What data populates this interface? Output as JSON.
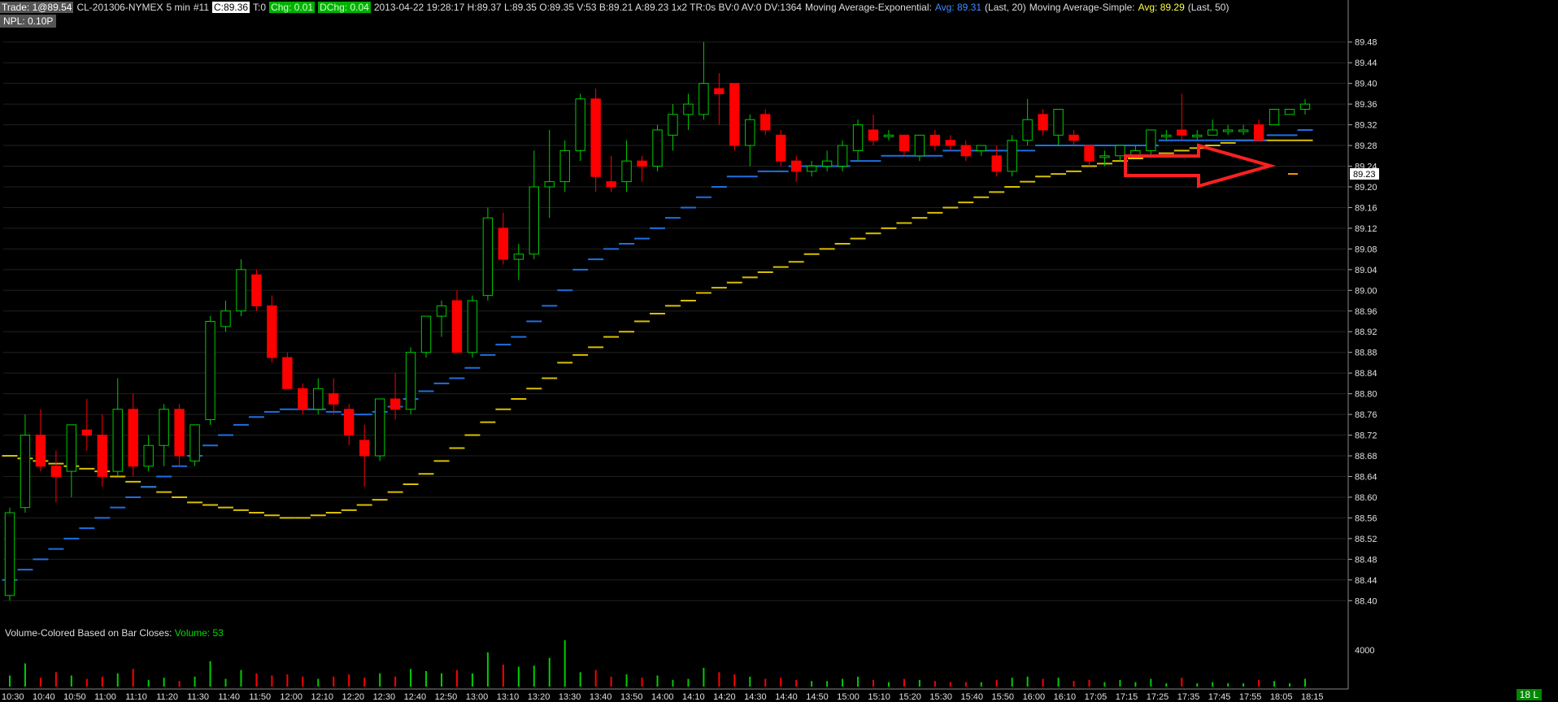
{
  "header": {
    "trade_label": "Trade: 1@89.54",
    "symbol": "CL-201306-NYMEX",
    "interval": "5 min",
    "bar_no": "#11",
    "close_chip": "C:89.36",
    "t_chip": "T:0",
    "chg_chip": "Chg: 0.01",
    "dchg_chip": "DChg: 0.04",
    "stats": "2013-04-22 19:28:17 H:89.37 L:89.35 O:89.35 V:53 B:89.21 A:89.23 1x2 TR:0s BV:0 AV:0 DV:1364",
    "ema_label": "Moving Average-Exponential:",
    "ema_avg": "Avg: 89.31",
    "ema_period": "(Last, 20)",
    "sma_label": "Moving Average-Simple:",
    "sma_avg": "Avg: 89.29",
    "sma_period": "(Last, 50)"
  },
  "npl": "NPL: 0.10P",
  "volume_label": "Volume-Colored Based on Bar Closes:",
  "volume_value": "Volume: 53",
  "price_tag": "89.23",
  "badge": "18 L",
  "colors": {
    "up": "#00cc00",
    "down": "#ff0000",
    "ema": "#1f6fe0",
    "sma": "#d8c000",
    "arrow": "#ff2020",
    "grid": "#202020",
    "axis_text": "#e0e0e0",
    "header_chip_gray": "#555555",
    "header_chip_green": "#00b000",
    "ema_text": "#3f8cff",
    "sma_text": "#ffff40",
    "badge_bg": "#008800"
  },
  "chart_data": {
    "type": "candlestick",
    "grid": true,
    "ylim": [
      88.38,
      89.5
    ],
    "yticks": [
      "89.48",
      "89.44",
      "89.40",
      "89.36",
      "89.32",
      "89.28",
      "89.24",
      "89.20",
      "89.16",
      "89.12",
      "89.08",
      "89.04",
      "89.00",
      "88.96",
      "88.92",
      "88.88",
      "88.84",
      "88.80",
      "88.76",
      "88.72",
      "88.68",
      "88.64",
      "88.60",
      "88.56",
      "88.52",
      "88.48",
      "88.44",
      "88.40"
    ],
    "volume_tick": "4000",
    "xticks": [
      "10:30",
      "10:40",
      "10:50",
      "11:00",
      "11:10",
      "11:20",
      "11:30",
      "11:40",
      "11:50",
      "12:00",
      "12:10",
      "12:20",
      "12:30",
      "12:40",
      "12:50",
      "13:00",
      "13:10",
      "13:20",
      "13:30",
      "13:40",
      "13:50",
      "14:00",
      "14:10",
      "14:20",
      "14:30",
      "14:40",
      "14:50",
      "15:00",
      "15:10",
      "15:20",
      "15:30",
      "15:40",
      "15:50",
      "16:00",
      "16:10",
      "17:05",
      "17:15",
      "17:25",
      "17:35",
      "17:45",
      "17:55",
      "18:05",
      "18:15"
    ],
    "bars": [
      {
        "o": 88.41,
        "h": 88.58,
        "l": 88.4,
        "c": 88.57,
        "v": 1000
      },
      {
        "o": 88.58,
        "h": 88.76,
        "l": 88.57,
        "c": 88.72,
        "v": 2100
      },
      {
        "o": 88.72,
        "h": 88.77,
        "l": 88.65,
        "c": 88.66,
        "v": 800
      },
      {
        "o": 88.66,
        "h": 88.69,
        "l": 88.59,
        "c": 88.64,
        "v": 1300
      },
      {
        "o": 88.65,
        "h": 88.74,
        "l": 88.6,
        "c": 88.74,
        "v": 1000
      },
      {
        "o": 88.73,
        "h": 88.79,
        "l": 88.69,
        "c": 88.72,
        "v": 700
      },
      {
        "o": 88.72,
        "h": 88.76,
        "l": 88.62,
        "c": 88.64,
        "v": 900
      },
      {
        "o": 88.65,
        "h": 88.83,
        "l": 88.64,
        "c": 88.77,
        "v": 1200
      },
      {
        "o": 88.77,
        "h": 88.8,
        "l": 88.64,
        "c": 88.66,
        "v": 1600
      },
      {
        "o": 88.66,
        "h": 88.72,
        "l": 88.65,
        "c": 88.7,
        "v": 600
      },
      {
        "o": 88.7,
        "h": 88.78,
        "l": 88.66,
        "c": 88.77,
        "v": 800
      },
      {
        "o": 88.77,
        "h": 88.78,
        "l": 88.66,
        "c": 88.68,
        "v": 500
      },
      {
        "o": 88.67,
        "h": 88.74,
        "l": 88.66,
        "c": 88.74,
        "v": 900
      },
      {
        "o": 88.75,
        "h": 88.95,
        "l": 88.74,
        "c": 88.94,
        "v": 2300
      },
      {
        "o": 88.93,
        "h": 88.98,
        "l": 88.92,
        "c": 88.96,
        "v": 700
      },
      {
        "o": 88.96,
        "h": 89.06,
        "l": 88.95,
        "c": 89.04,
        "v": 1500
      },
      {
        "o": 89.03,
        "h": 89.04,
        "l": 88.96,
        "c": 88.97,
        "v": 1200
      },
      {
        "o": 88.97,
        "h": 88.99,
        "l": 88.86,
        "c": 88.87,
        "v": 1000
      },
      {
        "o": 88.87,
        "h": 88.88,
        "l": 88.81,
        "c": 88.81,
        "v": 1100
      },
      {
        "o": 88.81,
        "h": 88.82,
        "l": 88.76,
        "c": 88.77,
        "v": 900
      },
      {
        "o": 88.77,
        "h": 88.83,
        "l": 88.76,
        "c": 88.81,
        "v": 700
      },
      {
        "o": 88.8,
        "h": 88.83,
        "l": 88.76,
        "c": 88.78,
        "v": 900
      },
      {
        "o": 88.77,
        "h": 88.78,
        "l": 88.7,
        "c": 88.72,
        "v": 1100
      },
      {
        "o": 88.71,
        "h": 88.74,
        "l": 88.62,
        "c": 88.68,
        "v": 800
      },
      {
        "o": 88.68,
        "h": 88.79,
        "l": 88.67,
        "c": 88.79,
        "v": 1200
      },
      {
        "o": 88.79,
        "h": 88.84,
        "l": 88.75,
        "c": 88.77,
        "v": 900
      },
      {
        "o": 88.77,
        "h": 88.89,
        "l": 88.76,
        "c": 88.88,
        "v": 1600
      },
      {
        "o": 88.88,
        "h": 88.95,
        "l": 88.87,
        "c": 88.95,
        "v": 1400
      },
      {
        "o": 88.95,
        "h": 88.98,
        "l": 88.91,
        "c": 88.97,
        "v": 1200
      },
      {
        "o": 88.98,
        "h": 89.0,
        "l": 88.88,
        "c": 88.88,
        "v": 1500
      },
      {
        "o": 88.88,
        "h": 88.99,
        "l": 88.87,
        "c": 88.98,
        "v": 1200
      },
      {
        "o": 88.99,
        "h": 89.16,
        "l": 88.98,
        "c": 89.14,
        "v": 3100
      },
      {
        "o": 89.12,
        "h": 89.15,
        "l": 89.05,
        "c": 89.06,
        "v": 2000
      },
      {
        "o": 89.06,
        "h": 89.09,
        "l": 89.02,
        "c": 89.07,
        "v": 1800
      },
      {
        "o": 89.07,
        "h": 89.27,
        "l": 89.06,
        "c": 89.2,
        "v": 1900
      },
      {
        "o": 89.2,
        "h": 89.31,
        "l": 89.14,
        "c": 89.21,
        "v": 2600
      },
      {
        "o": 89.21,
        "h": 89.29,
        "l": 89.19,
        "c": 89.27,
        "v": 4200
      },
      {
        "o": 89.27,
        "h": 89.38,
        "l": 89.25,
        "c": 89.37,
        "v": 1300
      },
      {
        "o": 89.37,
        "h": 89.39,
        "l": 89.19,
        "c": 89.22,
        "v": 1500
      },
      {
        "o": 89.21,
        "h": 89.26,
        "l": 89.19,
        "c": 89.2,
        "v": 900
      },
      {
        "o": 89.21,
        "h": 89.29,
        "l": 89.19,
        "c": 89.25,
        "v": 1100
      },
      {
        "o": 89.25,
        "h": 89.26,
        "l": 89.21,
        "c": 89.24,
        "v": 800
      },
      {
        "o": 89.24,
        "h": 89.32,
        "l": 89.23,
        "c": 89.31,
        "v": 1000
      },
      {
        "o": 89.3,
        "h": 89.36,
        "l": 89.27,
        "c": 89.34,
        "v": 600
      },
      {
        "o": 89.34,
        "h": 89.38,
        "l": 89.31,
        "c": 89.36,
        "v": 700
      },
      {
        "o": 89.34,
        "h": 89.48,
        "l": 89.33,
        "c": 89.4,
        "v": 1700
      },
      {
        "o": 89.39,
        "h": 89.42,
        "l": 89.32,
        "c": 89.38,
        "v": 1300
      },
      {
        "o": 89.4,
        "h": 89.4,
        "l": 89.27,
        "c": 89.28,
        "v": 1100
      },
      {
        "o": 89.28,
        "h": 89.34,
        "l": 89.24,
        "c": 89.33,
        "v": 900
      },
      {
        "o": 89.34,
        "h": 89.35,
        "l": 89.3,
        "c": 89.31,
        "v": 700
      },
      {
        "o": 89.3,
        "h": 89.31,
        "l": 89.24,
        "c": 89.25,
        "v": 800
      },
      {
        "o": 89.25,
        "h": 89.26,
        "l": 89.21,
        "c": 89.23,
        "v": 600
      },
      {
        "o": 89.23,
        "h": 89.25,
        "l": 89.22,
        "c": 89.24,
        "v": 500
      },
      {
        "o": 89.24,
        "h": 89.27,
        "l": 89.23,
        "c": 89.25,
        "v": 500
      },
      {
        "o": 89.24,
        "h": 89.29,
        "l": 89.23,
        "c": 89.28,
        "v": 700
      },
      {
        "o": 89.27,
        "h": 89.33,
        "l": 89.25,
        "c": 89.32,
        "v": 900
      },
      {
        "o": 89.31,
        "h": 89.34,
        "l": 89.28,
        "c": 89.29,
        "v": 600
      },
      {
        "o": 89.3,
        "h": 89.31,
        "l": 89.29,
        "c": 89.3,
        "v": 400
      },
      {
        "o": 89.3,
        "h": 89.3,
        "l": 89.26,
        "c": 89.27,
        "v": 700
      },
      {
        "o": 89.26,
        "h": 89.3,
        "l": 89.25,
        "c": 89.3,
        "v": 600
      },
      {
        "o": 89.3,
        "h": 89.31,
        "l": 89.27,
        "c": 89.28,
        "v": 500
      },
      {
        "o": 89.29,
        "h": 89.3,
        "l": 89.27,
        "c": 89.28,
        "v": 400
      },
      {
        "o": 89.28,
        "h": 89.29,
        "l": 89.25,
        "c": 89.26,
        "v": 400
      },
      {
        "o": 89.27,
        "h": 89.28,
        "l": 89.26,
        "c": 89.28,
        "v": 400
      },
      {
        "o": 89.26,
        "h": 89.28,
        "l": 89.22,
        "c": 89.23,
        "v": 600
      },
      {
        "o": 89.23,
        "h": 89.3,
        "l": 89.22,
        "c": 89.29,
        "v": 800
      },
      {
        "o": 89.29,
        "h": 89.37,
        "l": 89.28,
        "c": 89.33,
        "v": 900
      },
      {
        "o": 89.34,
        "h": 89.35,
        "l": 89.3,
        "c": 89.31,
        "v": 700
      },
      {
        "o": 89.3,
        "h": 89.35,
        "l": 89.28,
        "c": 89.35,
        "v": 800
      },
      {
        "o": 89.3,
        "h": 89.31,
        "l": 89.28,
        "c": 89.29,
        "v": 500
      },
      {
        "o": 89.28,
        "h": 89.28,
        "l": 89.24,
        "c": 89.25,
        "v": 600
      },
      {
        "o": 89.26,
        "h": 89.27,
        "l": 89.24,
        "c": 89.26,
        "v": 400
      },
      {
        "o": 89.26,
        "h": 89.28,
        "l": 89.25,
        "c": 89.28,
        "v": 600
      },
      {
        "o": 89.26,
        "h": 89.28,
        "l": 89.26,
        "c": 89.27,
        "v": 400
      },
      {
        "o": 89.27,
        "h": 89.31,
        "l": 89.26,
        "c": 89.31,
        "v": 700
      },
      {
        "o": 89.3,
        "h": 89.31,
        "l": 89.29,
        "c": 89.3,
        "v": 300
      },
      {
        "o": 89.31,
        "h": 89.38,
        "l": 89.29,
        "c": 89.3,
        "v": 800
      },
      {
        "o": 89.3,
        "h": 89.31,
        "l": 89.29,
        "c": 89.3,
        "v": 300
      },
      {
        "o": 89.3,
        "h": 89.33,
        "l": 89.3,
        "c": 89.31,
        "v": 400
      },
      {
        "o": 89.31,
        "h": 89.32,
        "l": 89.3,
        "c": 89.31,
        "v": 300
      },
      {
        "o": 89.31,
        "h": 89.32,
        "l": 89.3,
        "c": 89.31,
        "v": 300
      },
      {
        "o": 89.32,
        "h": 89.33,
        "l": 89.29,
        "c": 89.29,
        "v": 600
      },
      {
        "o": 89.32,
        "h": 89.35,
        "l": 89.32,
        "c": 89.35,
        "v": 500
      },
      {
        "o": 89.34,
        "h": 89.35,
        "l": 89.34,
        "c": 89.35,
        "v": 300
      },
      {
        "o": 89.35,
        "h": 89.37,
        "l": 89.34,
        "c": 89.36,
        "v": 700
      }
    ],
    "ema": [
      88.44,
      88.46,
      88.48,
      88.5,
      88.52,
      88.54,
      88.56,
      88.58,
      88.6,
      88.62,
      88.64,
      88.66,
      88.68,
      88.7,
      88.72,
      88.74,
      88.755,
      88.765,
      88.77,
      88.77,
      88.77,
      88.765,
      88.76,
      88.76,
      88.765,
      88.775,
      88.79,
      88.805,
      88.82,
      88.83,
      88.85,
      88.875,
      88.895,
      88.91,
      88.94,
      88.97,
      89.0,
      89.04,
      89.06,
      89.08,
      89.09,
      89.1,
      89.12,
      89.14,
      89.16,
      89.18,
      89.2,
      89.22,
      89.22,
      89.23,
      89.23,
      89.24,
      89.24,
      89.24,
      89.24,
      89.25,
      89.25,
      89.26,
      89.26,
      89.26,
      89.26,
      89.27,
      89.27,
      89.27,
      89.27,
      89.27,
      89.27,
      89.28,
      89.28,
      89.28,
      89.28,
      89.28,
      89.28,
      89.28,
      89.28,
      89.29,
      89.29,
      89.29,
      89.29,
      89.29,
      89.29,
      89.29,
      89.3,
      89.3,
      89.31
    ],
    "sma": [
      88.68,
      88.675,
      88.67,
      88.665,
      88.66,
      88.655,
      88.65,
      88.64,
      88.63,
      88.62,
      88.61,
      88.6,
      88.59,
      88.585,
      88.58,
      88.575,
      88.57,
      88.565,
      88.56,
      88.56,
      88.565,
      88.57,
      88.575,
      88.585,
      88.595,
      88.61,
      88.625,
      88.645,
      88.67,
      88.695,
      88.72,
      88.745,
      88.77,
      88.79,
      88.81,
      88.83,
      88.86,
      88.875,
      88.89,
      88.91,
      88.92,
      88.94,
      88.955,
      88.97,
      88.98,
      88.995,
      89.005,
      89.015,
      89.025,
      89.035,
      89.045,
      89.055,
      89.07,
      89.08,
      89.09,
      89.1,
      89.11,
      89.12,
      89.13,
      89.14,
      89.15,
      89.16,
      89.17,
      89.18,
      89.19,
      89.2,
      89.21,
      89.22,
      89.225,
      89.23,
      89.24,
      89.245,
      89.25,
      89.255,
      89.26,
      89.265,
      89.27,
      89.275,
      89.28,
      89.285,
      89.29,
      89.29,
      89.29,
      89.29,
      89.29
    ]
  }
}
